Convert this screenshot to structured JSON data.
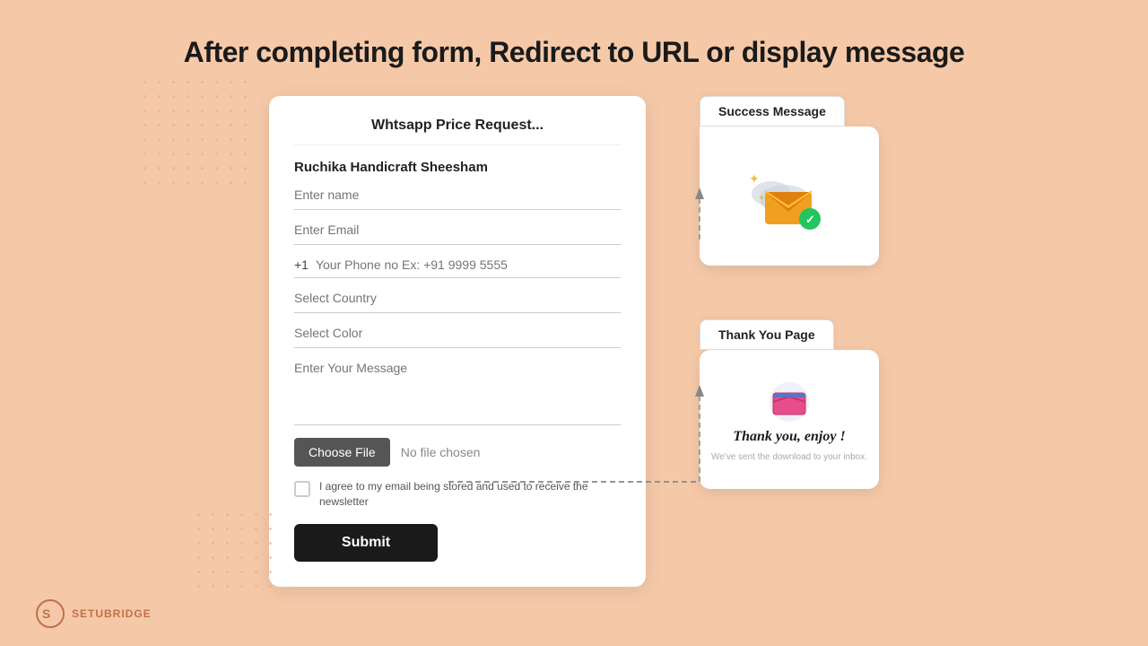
{
  "heading": "After completing form, Redirect to URL or display message",
  "form": {
    "title": "Whtsapp Price Request...",
    "product_name": "Ruchika Handicraft Sheesham",
    "fields": {
      "name_placeholder": "Enter name",
      "email_placeholder": "Enter Email",
      "phone_code": "+1",
      "phone_placeholder": "Your Phone no Ex: +91 9999 5555",
      "country_placeholder": "Select Country",
      "color_placeholder": "Select Color",
      "message_placeholder": "Enter Your Message",
      "file_btn_label": "Choose File",
      "no_file_text": "No file chosen",
      "checkbox_label": "I agree to my email being stored and used to receive the newsletter",
      "submit_label": "Submit"
    }
  },
  "success_panel": {
    "label": "Success Message"
  },
  "thankyou_panel": {
    "label": "Thank You Page",
    "title": "Thank you, enjoy !",
    "subtitle": "We've sent the download to your inbox."
  },
  "logo": {
    "text": "SETUBRIDGE"
  },
  "colors": {
    "background": "#f5c9a8",
    "card_bg": "#ffffff",
    "submit_bg": "#1a1a1a",
    "choose_file_bg": "#555555",
    "accent_orange": "#c0714a"
  }
}
